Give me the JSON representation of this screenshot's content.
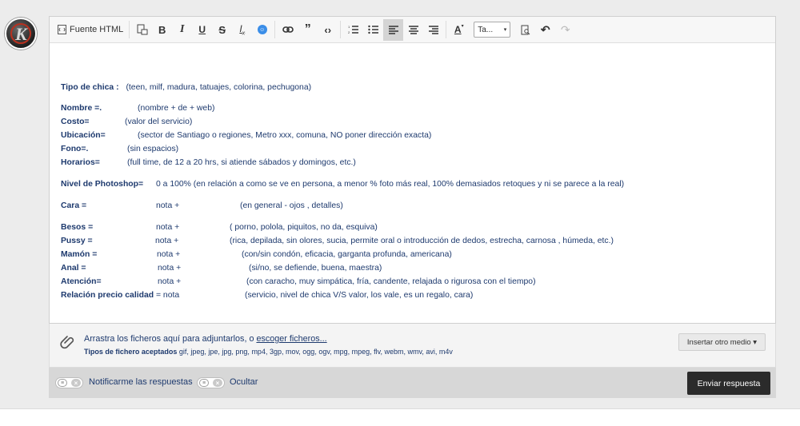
{
  "toolbar": {
    "source_label": "Fuente HTML",
    "format_select": "Ta...",
    "accent_color": "#d4d4d4"
  },
  "content": {
    "tipo": {
      "label": "Tipo de chica :",
      "value": "(teen, milf, madura, tatuajes, colorina, pechugona)"
    },
    "nombre": {
      "label": "Nombre =.",
      "value": "(nombre + de + web)"
    },
    "costo": {
      "label": "Costo=",
      "value": "(valor del servicio)"
    },
    "ubicacion": {
      "label": "Ubicación=",
      "value": "(sector de Santiago o regiones, Metro xxx, comuna, NO poner dirección exacta)"
    },
    "fono": {
      "label": "Fono=.",
      "value": "(sin espacios)"
    },
    "horarios": {
      "label": "Horarios=",
      "value": "(full time, de 12 a 20 hrs, si atiende sábados y domingos, etc.)"
    },
    "photoshop": {
      "label": "Nivel de Photoshop=",
      "value": "0 a 100% (en relación a como se ve en persona, a menor % foto más real, 100% demasiados retoques y ni se parece a la real)"
    },
    "cara": {
      "label": "Cara =",
      "nota": "nota +",
      "desc": "(en general - ojos , detalles)"
    },
    "besos": {
      "label": "Besos =",
      "nota": "nota +",
      "desc": "( porno, polola, piquitos, no da, esquiva)"
    },
    "pussy": {
      "label": "Pussy =",
      "nota": "nota +",
      "desc": "(rica, depilada, sin olores, sucia, permite oral o introducción de dedos, estrecha, carnosa , húmeda, etc.)"
    },
    "mamon": {
      "label": "Mamón =",
      "nota": "nota +",
      "desc": "(con/sin condón, eficacia, garganta profunda, americana)"
    },
    "anal": {
      "label": "Anal =",
      "nota": "nota +",
      "desc": "(si/no, se defiende, buena, maestra)"
    },
    "atencion": {
      "label": "Atención=",
      "nota": "nota +",
      "desc": "(con caracho, muy simpática, fría, candente, relajada o rigurosa con el tiempo)"
    },
    "relacion": {
      "label": "Relación precio calidad",
      "nota": "= nota",
      "desc": "(servicio, nivel de chica V/S valor, los vale, es un regalo, cara)"
    }
  },
  "attach": {
    "text": "Arrastra los ficheros aquí para adjuntarlos, o ",
    "link": "escoger ficheros...",
    "types_label": "Tipos de fichero aceptados",
    "types_value": " gif, jpeg, jpe, jpg, png, mp4, 3gp, mov, ogg, ogv, mpg, mpeg, flv, webm, wmv, avi, m4v",
    "insert_button": "Insertar otro medio ▾"
  },
  "bottom": {
    "notify_label": "Notificarme las respuestas",
    "hide_label": "Ocultar",
    "send_button": "Enviar respuesta"
  }
}
